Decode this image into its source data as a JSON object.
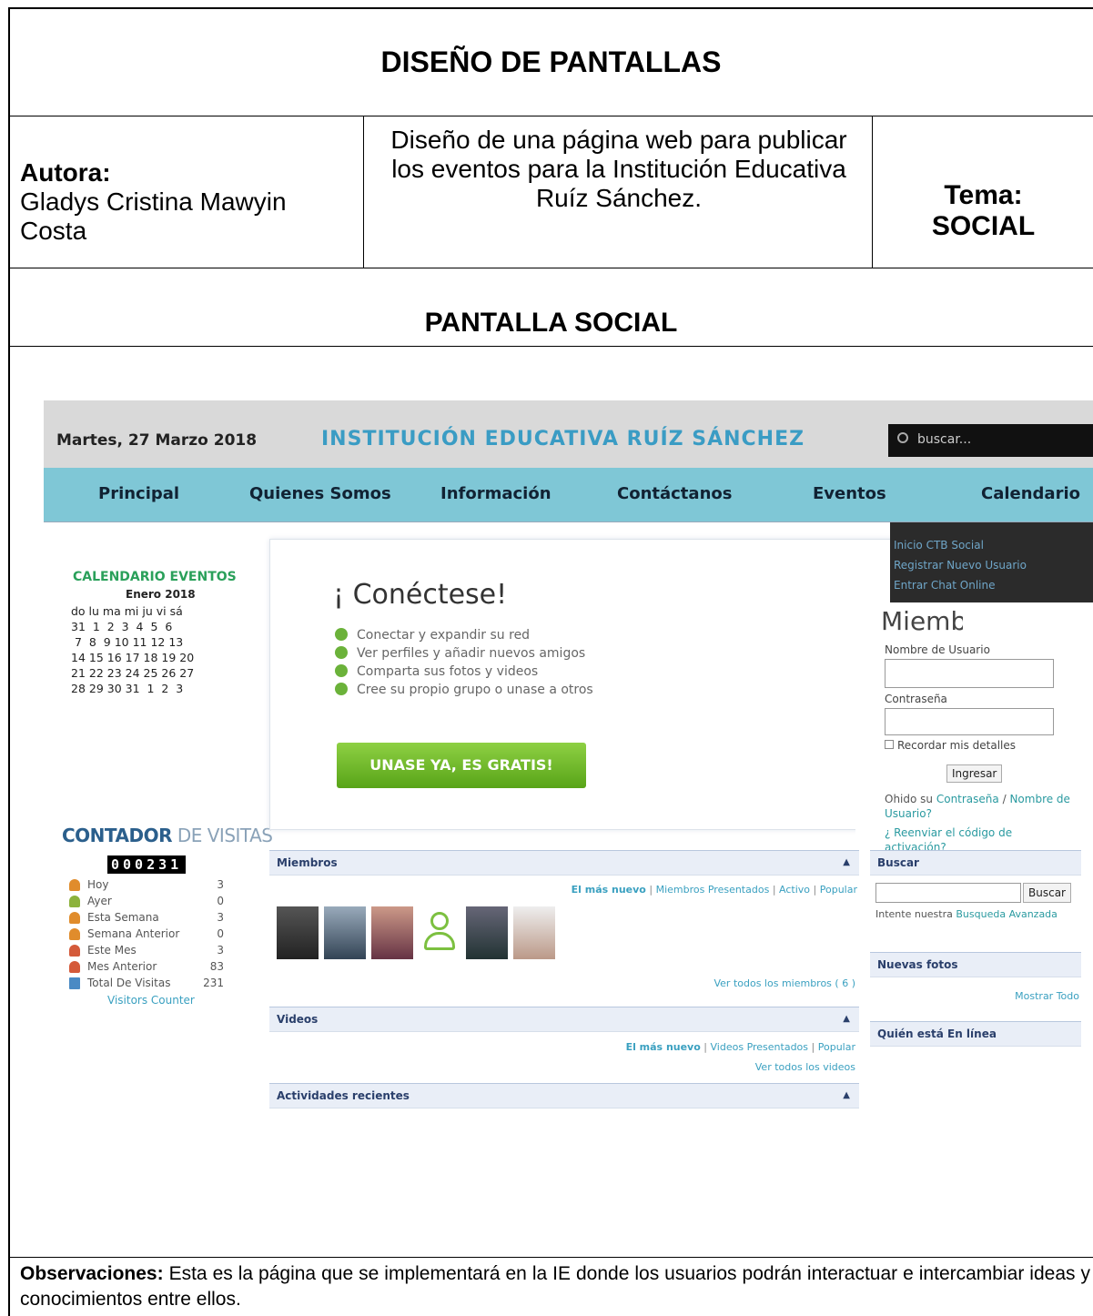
{
  "header_title": "DISEÑO DE PANTALLAS",
  "author_label": "Autora:",
  "author_name": "Gladys Cristina Mawyin Costa",
  "description": "Diseño de una página web para publicar los eventos para la Institución Educativa Ruíz Sánchez.",
  "theme_label": "Tema:",
  "theme_value": "SOCIAL",
  "screen_title": "PANTALLA SOCIAL",
  "observations_label": "Observaciones:",
  "observations_text": "Esta es la página que se implementará en la IE donde los usuarios podrán interactuar e intercambiar ideas y conocimientos entre ellos.",
  "site": {
    "date": "Martes, 27 Marzo 2018",
    "title": "INSTITUCIÓN EDUCATIVA RUÍZ SÁNCHEZ",
    "search_placeholder": "buscar...",
    "nav": [
      "Principal",
      "Quienes Somos",
      "Información",
      "Contáctanos",
      "Eventos",
      "Calendario"
    ],
    "dropdown": [
      "Inicio CTB Social",
      "Registrar Nuevo Usuario",
      "Entrar Chat Online"
    ],
    "calendar": {
      "title": "CALENDARIO EVENTOS",
      "month": "Enero 2018",
      "rows": [
        "do lu ma mi ju vi sá",
        "31  1  2  3  4  5  6",
        " 7  8  9 10 11 12 13",
        "14 15 16 17 18 19 20",
        "21 22 23 24 25 26 27",
        "28 29 30 31  1  2  3"
      ]
    },
    "counter": {
      "title_bold": "CONTADOR",
      "title_rest": " DE VISITAS",
      "digits": "000231",
      "rows": [
        {
          "label": "Hoy",
          "value": "3"
        },
        {
          "label": "Ayer",
          "value": "0"
        },
        {
          "label": "Esta Semana",
          "value": "3"
        },
        {
          "label": "Semana Anterior",
          "value": "0"
        },
        {
          "label": "Este Mes",
          "value": "3"
        },
        {
          "label": "Mes Anterior",
          "value": "83"
        },
        {
          "label": "Total De Visitas",
          "value": "231"
        }
      ],
      "link": "Visitors Counter"
    },
    "connect": {
      "title": "¡ Conéctese!",
      "bullets": [
        "Conectar y expandir su red",
        "Ver perfiles y añadir nuevos amigos",
        "Comparta sus fotos y videos",
        "Cree su propio grupo o unase a otros"
      ],
      "cta": "UNASE YA, ES GRATIS!"
    },
    "login": {
      "heading_partial": "Miembros",
      "user_label": "Nombre de Usuario",
      "pass_label": "Contraseña",
      "remember": "Recordar mis detalles",
      "button": "Ingresar",
      "forgot_prefix": "Ohido su ",
      "forgot_pass": "Contraseña",
      "slash": " / ",
      "forgot_user": "Nombre de Usuario?",
      "resend": "¿ Reenviar el código de activación?"
    },
    "members": {
      "title": "Miembros",
      "tabs": [
        "El más nuevo",
        "Miembros Presentados",
        "Activo",
        "Popular"
      ],
      "view_all": "Ver todos los miembros ( 6 )"
    },
    "videos": {
      "title": "Videos",
      "tabs": [
        "El más nuevo",
        "Videos Presentados",
        "Popular"
      ],
      "view_all": "Ver todos los videos"
    },
    "activities": {
      "title": "Actividades recientes"
    },
    "search": {
      "title": "Buscar",
      "button": "Buscar",
      "hint_prefix": "Intente nuestra ",
      "hint_link": "Busqueda Avanzada"
    },
    "photos": {
      "title": "Nuevas fotos",
      "link": "Mostrar Todo"
    },
    "online": {
      "title": "Quién está En línea"
    }
  }
}
